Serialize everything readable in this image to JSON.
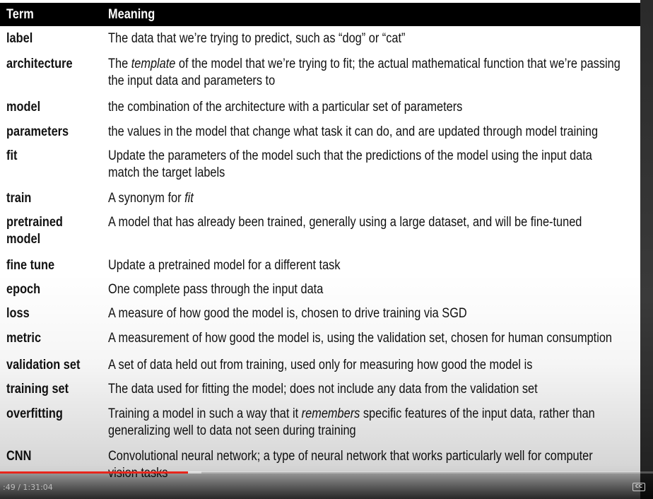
{
  "table": {
    "header": {
      "term": "Term",
      "meaning": "Meaning"
    },
    "rows": [
      {
        "term": "label",
        "meaning": "The data that we’re trying to predict, such as “dog” or “cat”"
      },
      {
        "term": "architecture",
        "meaning_pre": "The ",
        "meaning_em": "template",
        "meaning_post": " of the model that we’re trying to fit; the actual mathematical function that we’re passing the input data and parameters to"
      },
      {
        "term": "model",
        "meaning": "the combination of the architecture with a particular set of parameters"
      },
      {
        "term": "parameters",
        "meaning": "the values in the model that change what task it can do, and are updated through model training"
      },
      {
        "term": "fit",
        "meaning": "Update the parameters of the model such that the predictions of the model using the input data match the target labels"
      },
      {
        "term": "train",
        "meaning_pre": "A synonym for ",
        "meaning_em": "fit"
      },
      {
        "term": "pretrained model",
        "meaning": "A model that has already been trained, generally using a large dataset, and will be fine-tuned"
      },
      {
        "term": "fine tune",
        "meaning": "Update a pretrained model for a different task"
      },
      {
        "term": "epoch",
        "meaning": "One complete pass through the input data"
      },
      {
        "term": "loss",
        "meaning": "A measure of how good the model is, chosen to drive training via SGD"
      },
      {
        "term": "metric",
        "meaning": "A measurement of how good the model is, using the validation set, chosen for human consumption"
      },
      {
        "term": "validation set",
        "meaning": "A set of data held out from training, used only for measuring how good the model is"
      },
      {
        "term": "training set",
        "meaning": "The data used for fitting the model; does not include any data from the validation set"
      },
      {
        "term": "overfitting",
        "meaning_pre": "Training a model in such a way that it ",
        "meaning_em": "remembers",
        "meaning_post": " specific features of the input data, rather than generalizing well to data not seen during training"
      },
      {
        "term": "CNN",
        "meaning": "Convolutional neural network; a type of neural network that works particularly well for computer vision tasks"
      }
    ]
  },
  "player": {
    "time": ":49 / 1:31:04",
    "cc_label": "CC",
    "progress_played": 0.288,
    "progress_buffered": 0.308,
    "colors": {
      "played": "#e8261c"
    }
  }
}
